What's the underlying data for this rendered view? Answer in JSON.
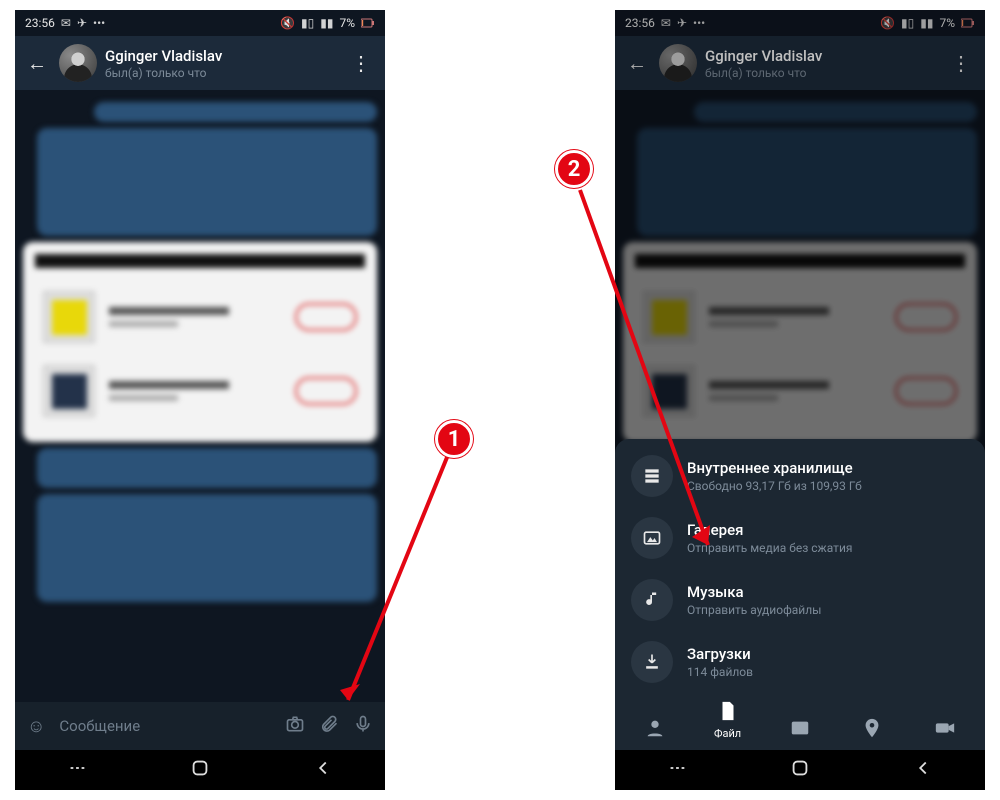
{
  "statusbar": {
    "time": "23:56",
    "battery_pct": "7%"
  },
  "chat": {
    "contact_name": "Gginger Vladislav",
    "last_seen": "был(а) только что"
  },
  "input": {
    "placeholder": "Сообщение"
  },
  "sheet": {
    "storage": {
      "title": "Внутреннее хранилище",
      "subtitle": "Свободно 93,17 Гб из 109,93 Гб"
    },
    "gallery": {
      "title": "Галерея",
      "subtitle": "Отправить медиа без сжатия"
    },
    "music": {
      "title": "Музыка",
      "subtitle": "Отправить аудиофайлы"
    },
    "downloads": {
      "title": "Загрузки",
      "subtitle": "114 файлов"
    },
    "tab_file_label": "Файл"
  },
  "callouts": {
    "one": "1",
    "two": "2"
  }
}
